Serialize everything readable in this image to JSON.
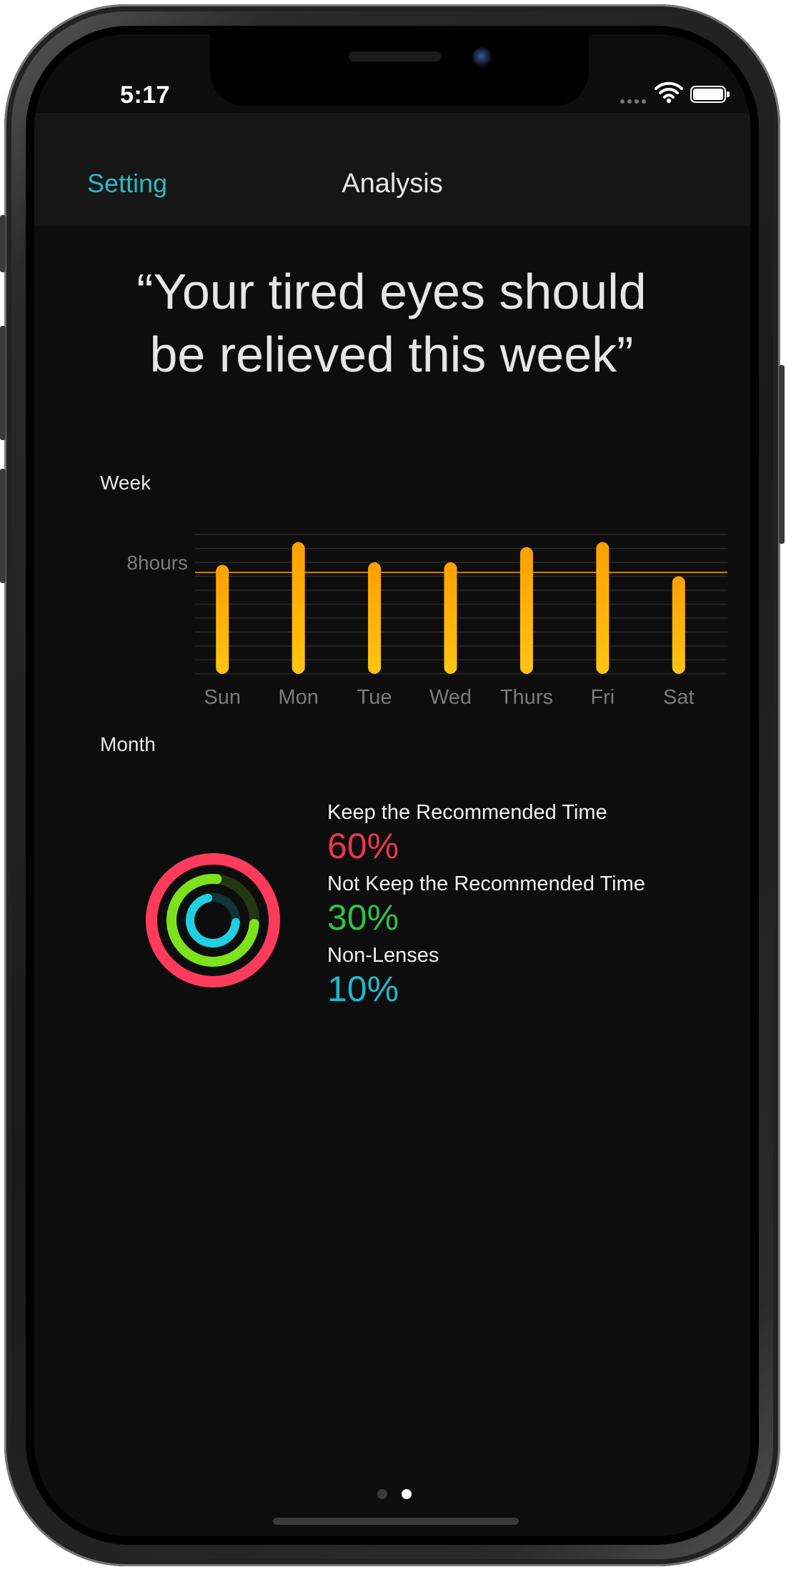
{
  "status_bar": {
    "time": "5:17",
    "wifi_icon": "wifi-icon",
    "battery_icon": "battery-icon"
  },
  "navbar": {
    "back_label": "Setting",
    "title": "Analysis"
  },
  "quote": {
    "line1": "“Your tired eyes should",
    "line2": "be relieved this week”"
  },
  "week": {
    "label": "Week",
    "reference_label": "8hours"
  },
  "month": {
    "label": "Month",
    "items": [
      {
        "name": "Keep the Recommended Time",
        "percent": "60%",
        "color": "#e8374f"
      },
      {
        "name": "Not Keep the Recommended Time",
        "percent": "30%",
        "color": "#33c04a"
      },
      {
        "name": "Non-Lenses",
        "percent": "10%",
        "color": "#20b8cc"
      }
    ]
  },
  "pager": {
    "count": 2,
    "active_index": 1
  },
  "chart_data": [
    {
      "type": "bar",
      "title": "Week",
      "categories": [
        "Sun",
        "Mon",
        "Tue",
        "Wed",
        "Thurs",
        "Fri",
        "Sat"
      ],
      "values": [
        8.6,
        10.4,
        8.8,
        8.8,
        10.0,
        10.4,
        7.7
      ],
      "reference_line": {
        "label": "8hours",
        "value": 8
      },
      "ylim": [
        0,
        11
      ],
      "grid": true,
      "bar_color_top": "#ffa000",
      "bar_color_bottom": "#ffc512",
      "reference_color": "#c8860e"
    },
    {
      "type": "pie",
      "title": "Month",
      "style": "activity-rings",
      "labels": [
        "Keep the Recommended Time",
        "Not Keep the Recommended Time",
        "Non-Lenses"
      ],
      "values": [
        60,
        30,
        10
      ],
      "ring_fractions": [
        1.0,
        0.75,
        0.7
      ],
      "colors": [
        "#ff3b5c",
        "#7ce21c",
        "#1fd0e0"
      ]
    }
  ]
}
